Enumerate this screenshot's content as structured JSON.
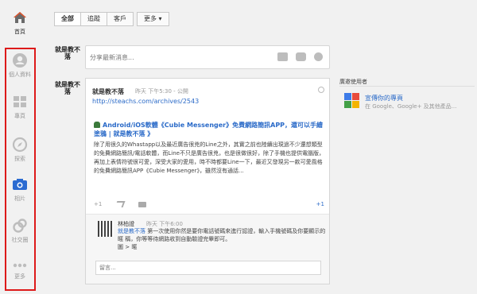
{
  "nav": {
    "items": [
      {
        "key": "home",
        "label": "首頁",
        "icon": "home-icon"
      },
      {
        "key": "profile",
        "label": "個人資料",
        "icon": "profile-icon"
      },
      {
        "key": "pages",
        "label": "專頁",
        "icon": "pages-icon"
      },
      {
        "key": "explore",
        "label": "探索",
        "icon": "compass-icon"
      },
      {
        "key": "photos",
        "label": "相片",
        "icon": "camera-icon"
      },
      {
        "key": "communities",
        "label": "社交圈",
        "icon": "circles-icon"
      },
      {
        "key": "more",
        "label": "更多",
        "icon": "more-icon"
      }
    ],
    "highlight_color": "#dd1a1a"
  },
  "filters": {
    "tabs": [
      "全部",
      "追蹤",
      "客戶"
    ],
    "more_label": "更多 ▾"
  },
  "share": {
    "logo_text": "就是教不落",
    "placeholder": "分享最新消息..."
  },
  "post": {
    "author": "就是教不落",
    "meta": "昨天 下午5:30 - 公開",
    "link": "http://steachs.com/archives/2543",
    "title": "Android/iOS軟體《Cubie Messenger》免費網路簡訊APP，還可以手繪塗鴉 | 就是教不落 》",
    "body": "除了用很久的Whastapp以及最近廣告很兇的Line之外，其實之前也陸續出現過不少還想類型的免費網路簡訊/電話軟體，而Line不只是廣告很兇，也是很做很好，除了手機也提供電腦版，再加上表情符號很可愛，深受大家的愛用，時不時都要Line一下，最近又發現另一款可愛風格的免費網路簡訊APP《Cubie Messenger》，雖然沒有通話...",
    "plus_label": "+1",
    "plus_count": "+1"
  },
  "comment": {
    "author": "林柏證",
    "time": "昨天 下午6:00",
    "text_prefix": "就是教不落",
    "text": " 第一次使用你然是要你電話號碼來進行認證，輸入手機號碼及你要顯示的 暱 稱，你等等待網路收到自動驗證完畢即可。",
    "footer": "圖 > 暱",
    "placeholder": "留言..."
  },
  "right": {
    "section_title": "廣邀使用者",
    "page_name": "宣傳你的專頁",
    "page_desc": "在 Google、Google+ 及其他產品..."
  }
}
